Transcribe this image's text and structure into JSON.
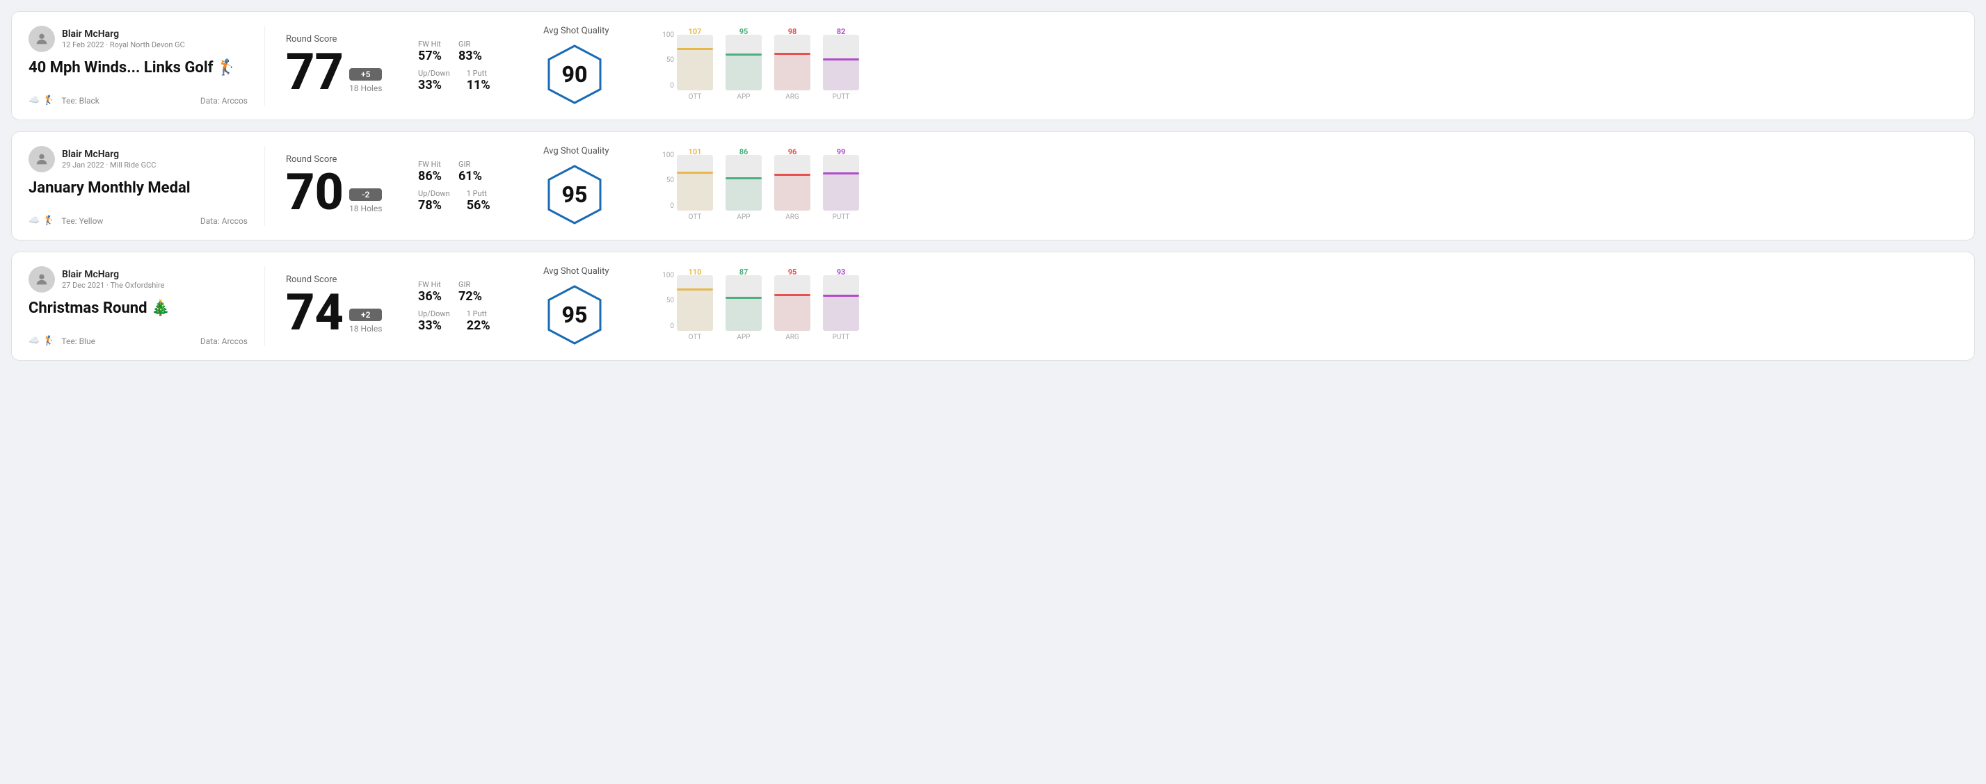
{
  "rounds": [
    {
      "id": "round1",
      "user": {
        "name": "Blair McHarg",
        "date_course": "12 Feb 2022 · Royal North Devon GC"
      },
      "title": "40 Mph Winds... Links Golf 🏌️",
      "tee": "Black",
      "data_source": "Data: Arccos",
      "score": {
        "label": "Round Score",
        "value": "77",
        "badge": "+5",
        "badge_type": "plus",
        "holes": "18 Holes"
      },
      "stats": {
        "fw_hit_label": "FW Hit",
        "fw_hit_value": "57%",
        "gir_label": "GIR",
        "gir_value": "83%",
        "updown_label": "Up/Down",
        "updown_value": "33%",
        "one_putt_label": "1 Putt",
        "one_putt_value": "11%"
      },
      "quality": {
        "label": "Avg Shot Quality",
        "value": "90",
        "hex_color": "#1a6bb5"
      },
      "chart": {
        "bars": [
          {
            "label": "OTT",
            "top_value": "107",
            "color": "#e8b84b",
            "height_pct": 72
          },
          {
            "label": "APP",
            "top_value": "95",
            "color": "#4caf7d",
            "height_pct": 62
          },
          {
            "label": "ARG",
            "top_value": "98",
            "color": "#e85050",
            "height_pct": 64
          },
          {
            "label": "PUTT",
            "top_value": "82",
            "color": "#b04cca",
            "height_pct": 54
          }
        ],
        "y_labels": [
          "100",
          "50",
          "0"
        ]
      }
    },
    {
      "id": "round2",
      "user": {
        "name": "Blair McHarg",
        "date_course": "29 Jan 2022 · Mill Ride GCC"
      },
      "title": "January Monthly Medal",
      "tee": "Yellow",
      "data_source": "Data: Arccos",
      "score": {
        "label": "Round Score",
        "value": "70",
        "badge": "-2",
        "badge_type": "minus",
        "holes": "18 Holes"
      },
      "stats": {
        "fw_hit_label": "FW Hit",
        "fw_hit_value": "86%",
        "gir_label": "GIR",
        "gir_value": "61%",
        "updown_label": "Up/Down",
        "updown_value": "78%",
        "one_putt_label": "1 Putt",
        "one_putt_value": "56%"
      },
      "quality": {
        "label": "Avg Shot Quality",
        "value": "95",
        "hex_color": "#1a6bb5"
      },
      "chart": {
        "bars": [
          {
            "label": "OTT",
            "top_value": "101",
            "color": "#e8b84b",
            "height_pct": 66
          },
          {
            "label": "APP",
            "top_value": "86",
            "color": "#4caf7d",
            "height_pct": 56
          },
          {
            "label": "ARG",
            "top_value": "96",
            "color": "#e85050",
            "height_pct": 63
          },
          {
            "label": "PUTT",
            "top_value": "99",
            "color": "#b04cca",
            "height_pct": 65
          }
        ],
        "y_labels": [
          "100",
          "50",
          "0"
        ]
      }
    },
    {
      "id": "round3",
      "user": {
        "name": "Blair McHarg",
        "date_course": "27 Dec 2021 · The Oxfordshire"
      },
      "title": "Christmas Round 🎄",
      "tee": "Blue",
      "data_source": "Data: Arccos",
      "score": {
        "label": "Round Score",
        "value": "74",
        "badge": "+2",
        "badge_type": "plus",
        "holes": "18 Holes"
      },
      "stats": {
        "fw_hit_label": "FW Hit",
        "fw_hit_value": "36%",
        "gir_label": "GIR",
        "gir_value": "72%",
        "updown_label": "Up/Down",
        "updown_value": "33%",
        "one_putt_label": "1 Putt",
        "one_putt_value": "22%"
      },
      "quality": {
        "label": "Avg Shot Quality",
        "value": "95",
        "hex_color": "#1a6bb5"
      },
      "chart": {
        "bars": [
          {
            "label": "OTT",
            "top_value": "110",
            "color": "#e8b84b",
            "height_pct": 72
          },
          {
            "label": "APP",
            "top_value": "87",
            "color": "#4caf7d",
            "height_pct": 57
          },
          {
            "label": "ARG",
            "top_value": "95",
            "color": "#e85050",
            "height_pct": 62
          },
          {
            "label": "PUTT",
            "top_value": "93",
            "color": "#b04cca",
            "height_pct": 61
          }
        ],
        "y_labels": [
          "100",
          "50",
          "0"
        ]
      }
    }
  ]
}
